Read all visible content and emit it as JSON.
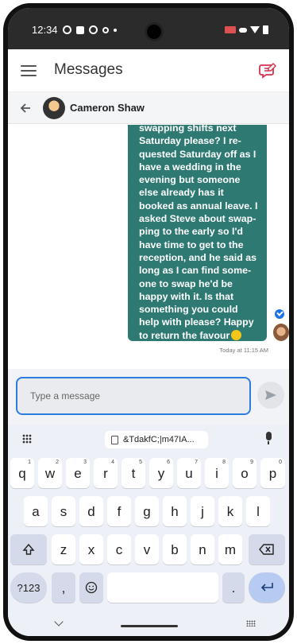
{
  "status_bar": {
    "time": "12:34"
  },
  "header": {
    "title": "Messages",
    "accent_color": "#d6304f"
  },
  "conversation": {
    "contact_name": "Cameron Shaw"
  },
  "message": {
    "lines": [
      "swapping shifts next",
      "Saturday please? I re-",
      "quested Saturday off as I",
      "have a wedding in the",
      "evening but someone",
      "else already has it",
      "booked as annual leave. I",
      "asked Steve about swap-",
      "ping to the early so I'd",
      "have time to get to the",
      "reception, and he said as",
      "long as I can find some-",
      "one to swap he'd be",
      "happy with it. Is that",
      "something you could",
      "help with please? Happy",
      "to return the favour"
    ],
    "bubble_color": "#2e7a73",
    "timestamp": "Today at 11:15 AM"
  },
  "composer": {
    "placeholder": "Type a message"
  },
  "keyboard": {
    "clipboard_text": "&TdakfC;|m47IA...",
    "row1": [
      {
        "key": "q",
        "hint": "1"
      },
      {
        "key": "w",
        "hint": "2"
      },
      {
        "key": "e",
        "hint": "3"
      },
      {
        "key": "r",
        "hint": "4"
      },
      {
        "key": "t",
        "hint": "5"
      },
      {
        "key": "y",
        "hint": "6"
      },
      {
        "key": "u",
        "hint": "7"
      },
      {
        "key": "i",
        "hint": "8"
      },
      {
        "key": "o",
        "hint": "9"
      },
      {
        "key": "p",
        "hint": "0"
      }
    ],
    "row2": [
      "a",
      "s",
      "d",
      "f",
      "g",
      "h",
      "j",
      "k",
      "l"
    ],
    "row3": [
      "z",
      "x",
      "c",
      "v",
      "b",
      "n",
      "m"
    ],
    "symbols_label": "?123",
    "comma": ",",
    "period": "."
  }
}
